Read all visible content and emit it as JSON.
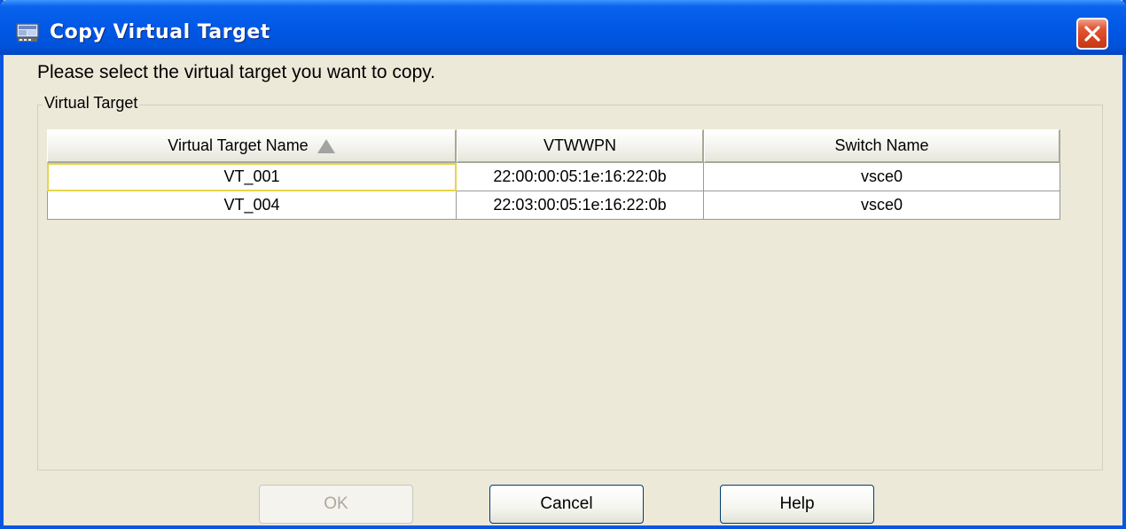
{
  "window": {
    "title": "Copy Virtual Target",
    "icon": "app-window-icon",
    "close_icon": "close-icon"
  },
  "prompt": "Please select the virtual target you want to copy.",
  "group": {
    "label": "Virtual Target"
  },
  "table": {
    "columns": [
      "Virtual Target Name",
      "VTWWPN",
      "Switch Name"
    ],
    "sort_column": "Virtual Target Name",
    "sort_direction": "ascending",
    "rows": [
      [
        "VT_001",
        "22:00:00:05:1e:16:22:0b",
        "vsce0"
      ],
      [
        "VT_004",
        "22:03:00:05:1e:16:22:0b",
        "vsce0"
      ]
    ]
  },
  "buttons": {
    "ok": "OK",
    "cancel": "Cancel",
    "help": "Help"
  },
  "colors": {
    "titlebar": "#0058e6",
    "close": "#d3421f",
    "dialog_bg": "#ece9d8",
    "focus": "#e6d64a"
  }
}
